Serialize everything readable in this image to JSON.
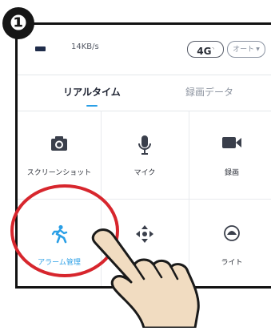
{
  "step_badge": "❶",
  "status_bar": {
    "speed": "14KB/s",
    "network": "4G",
    "quality": "オート"
  },
  "tabs": [
    {
      "label": "リアルタイム",
      "active": true
    },
    {
      "label": "録画データ",
      "active": false
    }
  ],
  "functions": [
    {
      "label": "スクリーンショット",
      "icon": "camera-icon"
    },
    {
      "label": "マイク",
      "icon": "microphone-icon"
    },
    {
      "label": "録画",
      "icon": "video-camera-icon"
    },
    {
      "label": "アラーム管理",
      "icon": "running-person-icon",
      "color": "#2a9fe6"
    },
    {
      "label": "",
      "icon": "move-arrows-icon"
    },
    {
      "label": "ライト",
      "icon": "light-icon"
    }
  ],
  "colors": {
    "accent": "#2a9fe6",
    "highlight": "#d7262d"
  }
}
